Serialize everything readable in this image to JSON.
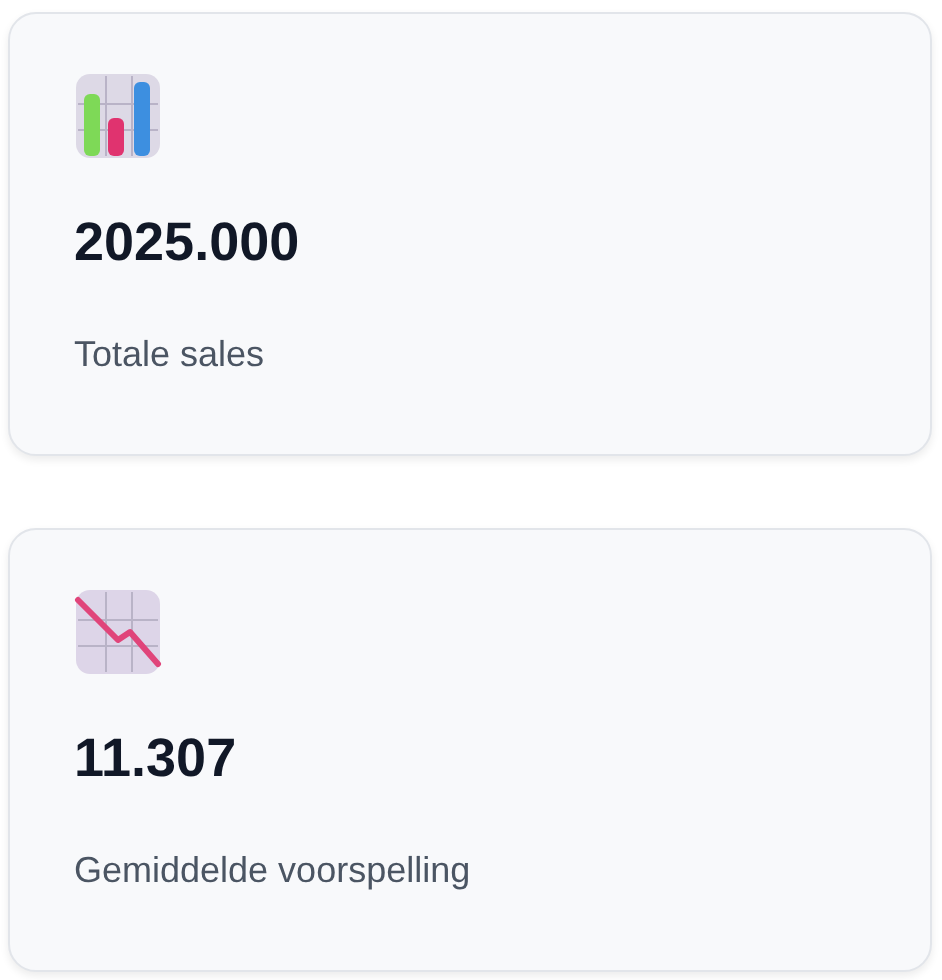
{
  "cards": [
    {
      "kind": "bar",
      "value": "2025.000",
      "label": "Totale sales"
    },
    {
      "kind": "trend",
      "value": "11.307",
      "label": "Gemiddelde voorspelling"
    }
  ]
}
